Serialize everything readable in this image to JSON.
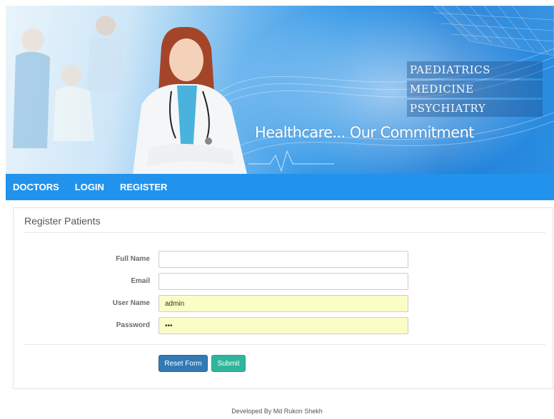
{
  "banner": {
    "departments": [
      "PAEDIATRICS",
      "MEDICINE",
      "PSYCHIATRY"
    ],
    "slogan": "Healthcare... Our Commitment"
  },
  "nav": {
    "items": [
      {
        "label": "DOCTORS"
      },
      {
        "label": "LOGIN"
      },
      {
        "label": "REGISTER"
      }
    ]
  },
  "form": {
    "title": "Register Patients",
    "fields": {
      "full_name": {
        "label": "Full Name",
        "value": ""
      },
      "email": {
        "label": "Email",
        "value": ""
      },
      "username": {
        "label": "User Name",
        "value": "admin"
      },
      "password": {
        "label": "Password",
        "value": "•••"
      }
    },
    "reset_label": "Reset Form",
    "submit_label": "Submit"
  },
  "footer": {
    "text": "Developed By Md Rukon Shekh"
  },
  "colors": {
    "nav": "#2293ec",
    "reset": "#327ab6",
    "submit": "#2fb59c",
    "autofill": "#fbfdc7"
  }
}
